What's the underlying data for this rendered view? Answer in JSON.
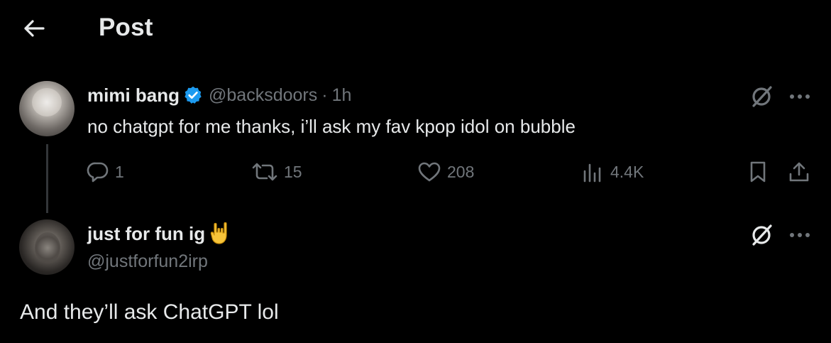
{
  "header": {
    "title": "Post"
  },
  "tweet": {
    "display_name": "mimi bang",
    "handle": "@backsdoors",
    "separator": "·",
    "time": "1h",
    "text": "no chatgpt for me thanks, i’ll ask my fav kpop idol on bubble",
    "stats": {
      "replies": "1",
      "reposts": "15",
      "likes": "208",
      "views": "4.4K"
    }
  },
  "reply": {
    "display_name": "just for fun ig",
    "handle": "@justforfun2irp",
    "text": "And they’ll ask ChatGPT lol"
  },
  "colors": {
    "background": "#000000",
    "primary_text": "#e7e9ea",
    "secondary_text": "#71767b",
    "verified_blue": "#1d9bf0",
    "thread_line": "#333639"
  },
  "icons": {
    "back": "arrow-left-icon",
    "verified": "verified-badge-icon",
    "grok": "grok-icon",
    "more": "more-horizontal-icon",
    "reply": "reply-icon",
    "repost": "repost-icon",
    "like": "heart-icon",
    "views": "views-icon",
    "bookmark": "bookmark-icon",
    "share": "share-icon",
    "emoji": "sign-of-horns-emoji-icon"
  }
}
